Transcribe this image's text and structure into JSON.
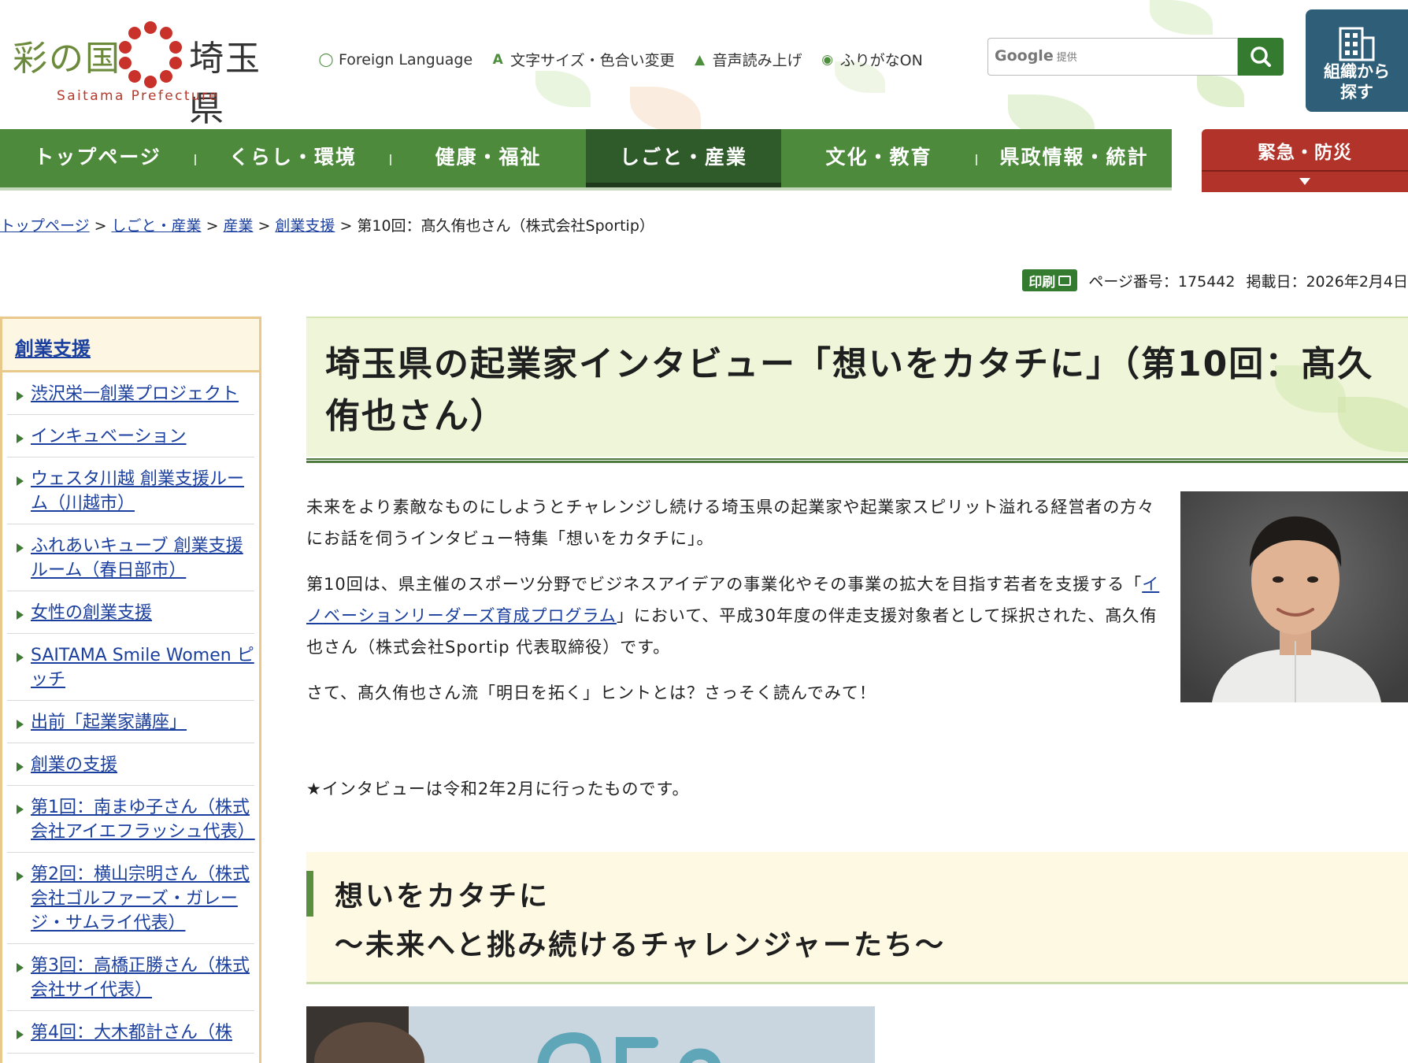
{
  "header": {
    "logo_left": "彩の国",
    "logo_right": "埼玉県",
    "logo_en": "Saitama Prefecture",
    "tools": [
      {
        "icon": "globe-icon",
        "label": "Foreign Language"
      },
      {
        "icon": "text-size-icon",
        "label": "文字サイズ・色合い変更"
      },
      {
        "icon": "speaker-icon",
        "label": "音声読み上げ"
      },
      {
        "icon": "furigana-icon",
        "label": "ふりがなON"
      }
    ],
    "search": {
      "brand": "Google",
      "brand_suffix": "提供"
    },
    "org_button": {
      "line1": "組織から",
      "line2": "探す"
    }
  },
  "nav": {
    "items": [
      "トップページ",
      "くらし・環境",
      "健康・福祉",
      "しごと・産業",
      "文化・教育",
      "県政情報・統計"
    ],
    "active": "しごと・産業",
    "emergency": "緊急・防災"
  },
  "breadcrumb": {
    "links": [
      "トップページ",
      "しごと・産業",
      "産業",
      "創業支援"
    ],
    "current": "第10回：髙久侑也さん（株式会社Sportip）",
    "separator": ">"
  },
  "meta": {
    "print": "印刷",
    "page_number": "ページ番号：175442",
    "published": "掲載日：2026年2月4日"
  },
  "sidebar": {
    "title": "創業支援",
    "items": [
      "渋沢栄一創業プロジェクト",
      "インキュベーション",
      "ウェスタ川越 創業支援ルーム（川越市）",
      "ふれあいキューブ 創業支援ルーム（春日部市）",
      "女性の創業支援",
      "SAITAMA Smile Women ピッチ",
      "出前「起業家講座」",
      "創業の支援",
      "第1回：南まゆ子さん（株式会社アイエフラッシュ代表）",
      "第2回：横山宗明さん（株式会社ゴルファーズ・ガレージ・サムライ代表）",
      "第3回：高橋正勝さん（株式会社サイ代表）",
      "第4回：大木都計さん（株"
    ]
  },
  "article": {
    "title": "埼玉県の起業家インタビュー「想いをカタチに」（第10回：髙久侑也さん）",
    "intro": "未来をより素敵なものにしようとチャレンジし続ける埼玉県の起業家や起業家スピリット溢れる経営者の方々にお話を伺うインタビュー特集「想いをカタチに」。",
    "p2_before": "第10回は、県主催のスポーツ分野でビジネスアイデアの事業化やその事業の拡大を目指す若者を支援する「",
    "p2_link": "イノベーションリーダーズ育成プログラム",
    "p2_after": "」において、平成30年度の伴走支援対象者として採択された、髙久侑也さん（株式会社Sportip 代表取締役）です。",
    "p3": "さて、髙久侑也さん流「明日を拓く」ヒントとは？さっそく読んでみて！",
    "note": "★インタビューは令和2年2月に行ったものです。",
    "h2_line1": "想いをカタチに",
    "h2_line2": "～未来へと挑み続けるチャレンジャーたち～"
  },
  "colors": {
    "nav_green": "#4d8a3c",
    "nav_active": "#2f5a2a",
    "emergency_red": "#b2332a",
    "link_blue": "#1a3f9e",
    "org_button": "#2f5f78",
    "sidebar_border": "#e9c98b",
    "title_bg": "#eef5d8"
  }
}
